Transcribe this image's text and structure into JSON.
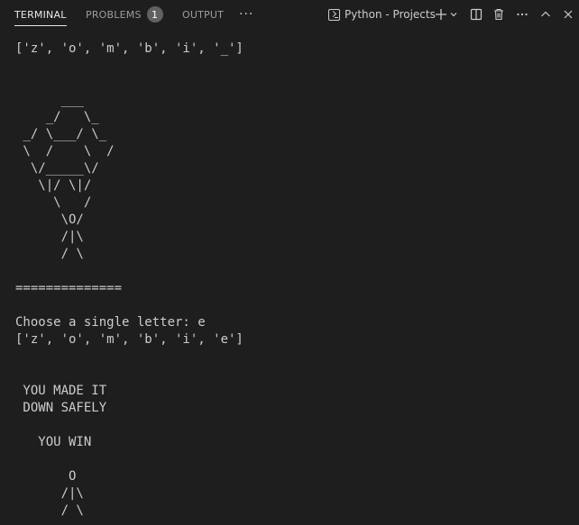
{
  "tabs": {
    "terminal": "TERMINAL",
    "problems": "PROBLEMS",
    "problems_count": "1",
    "output": "OUTPUT",
    "more": "···"
  },
  "toolbar": {
    "terminal_name": "Python - Projects",
    "icons": [
      "terminal-icon",
      "plus-icon",
      "chevron-down-icon",
      "split-icon",
      "trash-icon",
      "more-icon",
      "chevron-up-icon",
      "close-icon"
    ]
  },
  "terminal": {
    "lines": [
      "['z', 'o', 'm', 'b', 'i', '_']",
      "",
      "",
      "      ___",
      "    _/   \\_",
      " _/ \\___/ \\_",
      " \\  /    \\  /",
      "  \\/_____\\/",
      "   \\|/ \\|/",
      "     \\   /",
      "      \\O/",
      "      /|\\",
      "      / \\",
      "",
      "==============",
      "",
      "Choose a single letter: e",
      "['z', 'o', 'm', 'b', 'i', 'e']",
      "",
      "",
      " YOU MADE IT",
      " DOWN SAFELY",
      "",
      "   YOU WIN",
      "",
      "       O",
      "      /|\\",
      "      / \\",
      "=============="
    ]
  },
  "colors": {
    "background": "#1e1e1e",
    "text": "#cccccc",
    "tab_inactive": "#9d9d9d",
    "tab_active": "#e7e7e7",
    "badge": "#616161"
  }
}
